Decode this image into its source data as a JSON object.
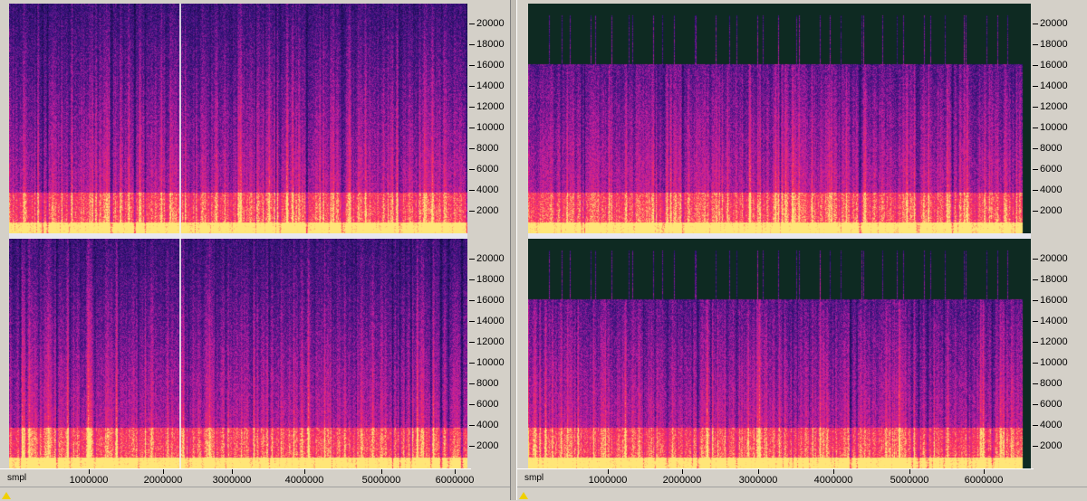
{
  "panes": [
    {
      "id": "left",
      "unit_label": "smpl",
      "freq_labels": [
        "20000",
        "18000",
        "16000",
        "14000",
        "12000",
        "10000",
        "8000",
        "6000",
        "4000",
        "2000"
      ],
      "time_labels": [
        "1000000",
        "2000000",
        "3000000",
        "4000000",
        "5000000",
        "6000000"
      ]
    },
    {
      "id": "right",
      "unit_label": "smpl",
      "freq_labels": [
        "20000",
        "18000",
        "16000",
        "14000",
        "12000",
        "10000",
        "8000",
        "6000",
        "4000",
        "2000"
      ],
      "time_labels": [
        "1000000",
        "2000000",
        "3000000",
        "4000000",
        "5000000",
        "6000000"
      ]
    }
  ],
  "colors": {
    "background": "#0a0a3a",
    "low": "#2a0a6a",
    "mid": "#c020a0",
    "high": "#ff3060",
    "peak": "#ffe060",
    "cutoff_band": "#0e2a22"
  }
}
